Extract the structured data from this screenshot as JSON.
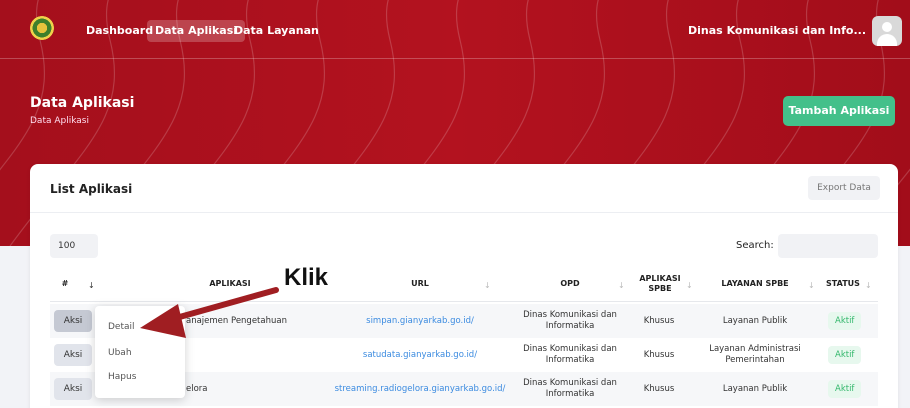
{
  "nav": {
    "items": [
      {
        "label": "Dashboard",
        "active": false
      },
      {
        "label": "Data Aplikasi",
        "active": true
      },
      {
        "label": "Data Layanan",
        "active": false
      }
    ],
    "user_name": "Dinas Komunikasi dan Info..."
  },
  "header": {
    "title": "Data Aplikasi",
    "breadcrumb": "Data Aplikasi",
    "add_button": "Tambah Aplikasi"
  },
  "card": {
    "title": "List Aplikasi",
    "export_button": "Export Data",
    "page_length": "100",
    "search_label": "Search:",
    "search_value": ""
  },
  "table": {
    "columns": [
      "#",
      "APLIKASI",
      "URL",
      "OPD",
      "APLIKASI SPBE",
      "LAYANAN SPBE",
      "STATUS"
    ],
    "rows": [
      {
        "action": "Aksi",
        "aplikasi": "anajemen Pengetahuan",
        "url": "simpan.gianyarkab.go.id/",
        "opd": "Dinas Komunikasi dan Informatika",
        "spbe": "Khusus",
        "layanan": "Layanan Publik",
        "status": "Aktif"
      },
      {
        "action": "Aksi",
        "aplikasi": "",
        "url": "satudata.gianyarkab.go.id/",
        "opd": "Dinas Komunikasi dan Informatika",
        "spbe": "Khusus",
        "layanan": "Layanan Administrasi Pemerintahan",
        "status": "Aktif"
      },
      {
        "action": "Aksi",
        "aplikasi": "elora",
        "url": "streaming.radiogelora.gianyarkab.go.id/",
        "opd": "Dinas Komunikasi dan Informatika",
        "spbe": "Khusus",
        "layanan": "Layanan Publik",
        "status": "Aktif"
      }
    ]
  },
  "dropdown": {
    "items": [
      "Detail",
      "Ubah",
      "Hapus"
    ]
  },
  "annotation": {
    "label": "Klik",
    "arrow_color": "#a01e22"
  },
  "colors": {
    "brand_red": "#b3121f",
    "accent_green": "#43c08a",
    "status_green": "#35b86d",
    "link_blue": "#3b8be0"
  }
}
